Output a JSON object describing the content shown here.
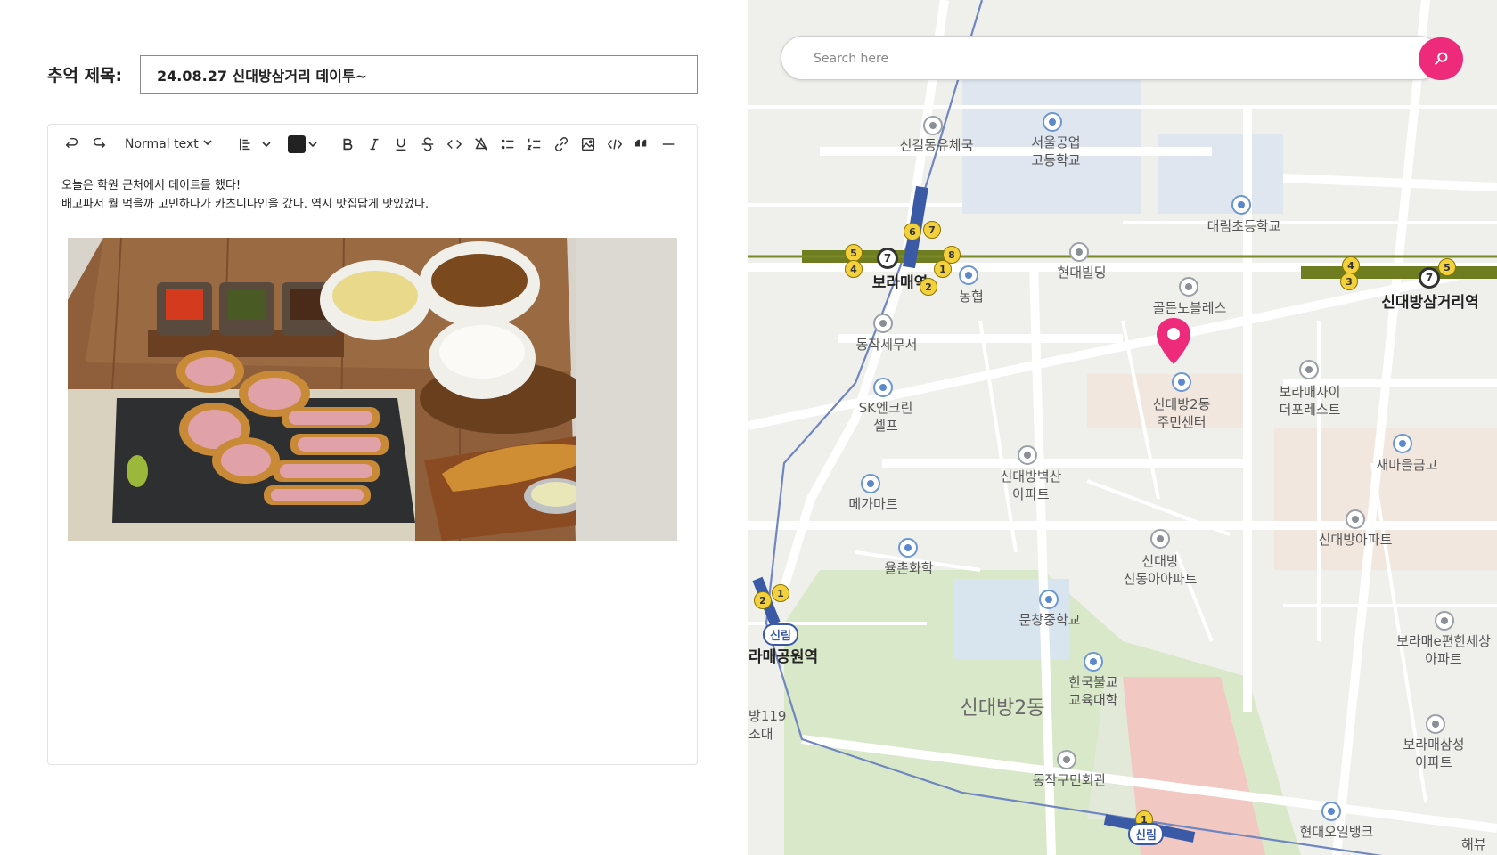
{
  "editor": {
    "title_label": "추억 제목:",
    "title_value": "24.08.27 신대방삼거리 데이투~",
    "toolbar": {
      "undo_icon": "undo-icon",
      "redo_icon": "redo-icon",
      "text_style": "Normal text",
      "align_icon": "align-left-icon",
      "text_color": "#222222",
      "icons": [
        "bold-icon",
        "italic-icon",
        "underline-icon",
        "strikethrough-icon",
        "code-icon",
        "clear-format-icon",
        "bullet-list-icon",
        "numbered-list-icon",
        "link-icon",
        "image-icon",
        "code-block-icon",
        "quote-icon",
        "horizontal-rule-icon"
      ]
    },
    "body_lines": [
      "오늘은 학원 근처에서 데이트를 했다!",
      "배고파서 뭘 먹을까 고민하다가 카츠디나인을 갔다. 역시 맛집답게 맛있었다."
    ],
    "image_icon": "tonkatsu-photo"
  },
  "map": {
    "search_placeholder": "Search here",
    "search_icon": "search-icon",
    "accent": "#ee2a7b",
    "labels": {
      "school1": "신길동유체국",
      "school2": "서울공업\n고등학교",
      "school3": "대림초등학교",
      "bldg1": "현대빌딩",
      "station1": "보라매역",
      "bank1": "농협",
      "bldg2": "골든노블레스",
      "station2": "신대방삼거리역",
      "tax": "동작세무서",
      "gas": "SK엔크린\n셀프",
      "center": "신대방2동\n주민센터",
      "apt1": "보라매자이\n더포레스트",
      "bank2": "새마을금고",
      "apt2": "신대방벽산\n아파트",
      "mart": "메가마트",
      "apt3": "신대방아파트",
      "chem": "율촌화학",
      "apt4": "신대방\n신동아아파트",
      "sillim1": "신림",
      "park_station": "라매공원역",
      "school4": "문창중학교",
      "apt5": "보라매e편한세상\n아파트",
      "univ": "한국불교\n교육대학",
      "district": "신대방2동",
      "fire": "방119\n조대",
      "apt6": "보라매삼성\n아파트",
      "hall": "동작구민회관",
      "bank3": "현대오일뱅크",
      "sillim2": "신림",
      "partial_right": "해뷰"
    }
  }
}
